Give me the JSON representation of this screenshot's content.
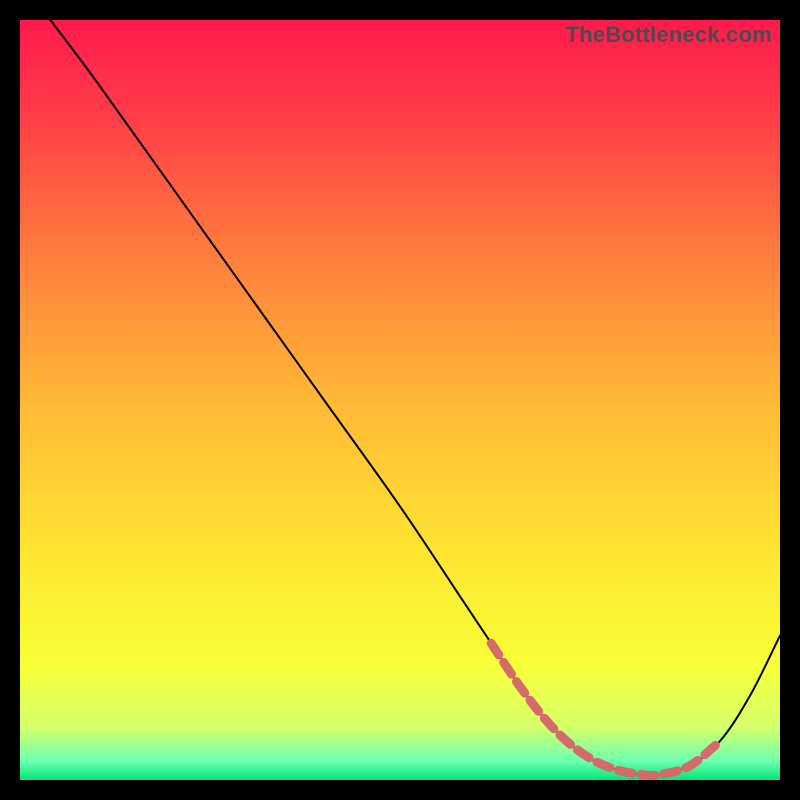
{
  "watermark": "TheBottleneck.com",
  "chart_data": {
    "type": "line",
    "title": "",
    "xlabel": "",
    "ylabel": "",
    "xlim": [
      0,
      100
    ],
    "ylim": [
      0,
      100
    ],
    "grid": false,
    "legend": false,
    "curves": [
      {
        "name": "bottleneck-curve",
        "color": "#000000",
        "width": 2,
        "x": [
          4,
          10,
          20,
          30,
          40,
          50,
          58,
          62,
          66,
          70,
          74,
          78,
          82,
          84,
          88,
          92,
          96,
          100
        ],
        "y": [
          100,
          92,
          78,
          64,
          50,
          36,
          24,
          18,
          12,
          7,
          3.5,
          1.5,
          0.7,
          0.7,
          1.8,
          5,
          11,
          19
        ]
      },
      {
        "name": "highlight-segment",
        "color": "#d46a6a",
        "width": 9,
        "dash": [
          14,
          9
        ],
        "x": [
          62,
          66,
          70,
          74,
          78,
          82,
          84,
          88,
          92
        ],
        "y": [
          18,
          12,
          7,
          3.5,
          1.5,
          0.7,
          0.7,
          1.8,
          5
        ]
      }
    ],
    "background_gradient": {
      "stops": [
        {
          "offset": 0.0,
          "color": "#ff1a4d"
        },
        {
          "offset": 0.12,
          "color": "#ff3b48"
        },
        {
          "offset": 0.3,
          "color": "#ff7a3d"
        },
        {
          "offset": 0.5,
          "color": "#ffb836"
        },
        {
          "offset": 0.7,
          "color": "#ffe531"
        },
        {
          "offset": 0.85,
          "color": "#f7ff38"
        },
        {
          "offset": 0.93,
          "color": "#d6ff6a"
        },
        {
          "offset": 0.975,
          "color": "#6dffb0"
        },
        {
          "offset": 1.0,
          "color": "#00e67a"
        }
      ]
    }
  }
}
